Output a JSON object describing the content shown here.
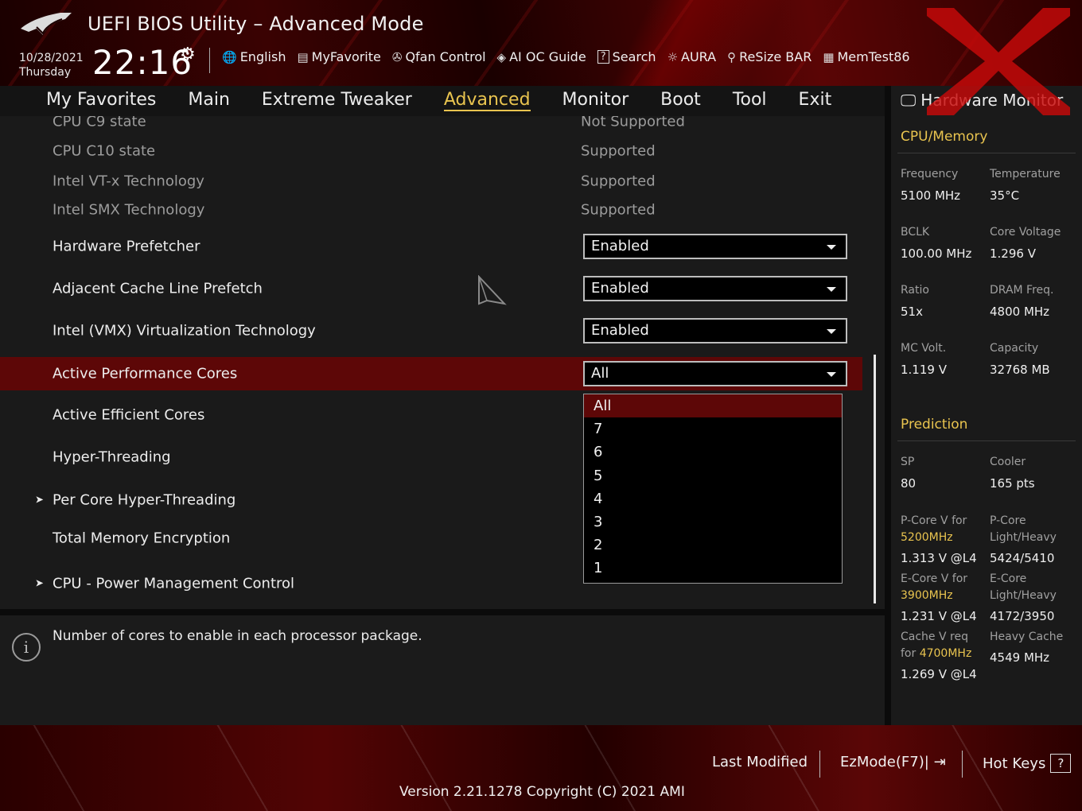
{
  "header": {
    "title": "UEFI BIOS Utility – Advanced Mode",
    "date": "10/28/2021",
    "day": "Thursday",
    "time": "22:16",
    "tools": [
      {
        "label": "English",
        "icon": "globe-icon"
      },
      {
        "label": "MyFavorite",
        "icon": "favorite-list-icon"
      },
      {
        "label": "Qfan Control",
        "icon": "fan-icon"
      },
      {
        "label": "AI OC Guide",
        "icon": "ai-chip-icon"
      },
      {
        "label": "Search",
        "icon": "help-search-icon"
      },
      {
        "label": "AURA",
        "icon": "aura-light-icon"
      },
      {
        "label": "ReSize BAR",
        "icon": "resize-bar-icon"
      },
      {
        "label": "MemTest86",
        "icon": "memtest-icon"
      }
    ]
  },
  "nav": {
    "tabs": [
      "My Favorites",
      "Main",
      "Extreme Tweaker",
      "Advanced",
      "Monitor",
      "Boot",
      "Tool",
      "Exit"
    ],
    "active": "Advanced"
  },
  "settings": {
    "c9_label": "CPU C9 state",
    "c9_value": "Not Supported",
    "c10_label": "CPU C10 state",
    "c10_value": "Supported",
    "vtx_label": "Intel VT-x Technology",
    "vtx_value": "Supported",
    "smx_label": "Intel SMX Technology",
    "smx_value": "Supported",
    "hwpf_label": "Hardware Prefetcher",
    "hwpf_value": "Enabled",
    "acl_label": "Adjacent Cache Line Prefetch",
    "acl_value": "Enabled",
    "vmx_label": "Intel (VMX) Virtualization Technology",
    "vmx_value": "Enabled",
    "apc_label": "Active Performance Cores",
    "apc_value": "All",
    "aec_label": "Active Efficient Cores",
    "ht_label": "Hyper-Threading",
    "pcht_label": "Per Core Hyper-Threading",
    "tme_label": "Total Memory Encryption",
    "pmc_label": "CPU - Power Management Control"
  },
  "dropdown_options": [
    "All",
    "7",
    "6",
    "5",
    "4",
    "3",
    "2",
    "1"
  ],
  "help_text": "Number of cores to enable in each processor package.",
  "hw_monitor": {
    "title": "Hardware Monitor",
    "cpu_section": "CPU/Memory",
    "frequency_label": "Frequency",
    "frequency": "5100 MHz",
    "temperature_label": "Temperature",
    "temperature": "35°C",
    "bclk_label": "BCLK",
    "bclk": "100.00 MHz",
    "core_voltage_label": "Core Voltage",
    "core_voltage": "1.296 V",
    "ratio_label": "Ratio",
    "ratio": "51x",
    "dram_label": "DRAM Freq.",
    "dram": "4800 MHz",
    "mcvolt_label": "MC Volt.",
    "mcvolt": "1.119 V",
    "capacity_label": "Capacity",
    "capacity": "32768 MB",
    "prediction_section": "Prediction",
    "sp_label": "SP",
    "sp": "80",
    "cooler_label": "Cooler",
    "cooler": "165 pts",
    "pcore_v_label": "P-Core V for",
    "pcore_v_freq": "5200MHz",
    "pcore_v": "1.313 V @L4",
    "pcore_lh_label_1": "P-Core",
    "pcore_lh_label_2": "Light/Heavy",
    "pcore_lh": "5424/5410",
    "ecore_v_label": "E-Core V for",
    "ecore_v_freq": "3900MHz",
    "ecore_v": "1.231 V @L4",
    "ecore_lh_label_1": "E-Core",
    "ecore_lh_label_2": "Light/Heavy",
    "ecore_lh": "4172/3950",
    "cache_v_label": "Cache V req",
    "cache_v_for": "for",
    "cache_v_freq": "4700MHz",
    "cache_v": "1.269 V @L4",
    "heavy_cache_label": "Heavy Cache",
    "heavy_cache": "4549 MHz"
  },
  "footer": {
    "last_modified": "Last Modified",
    "ezmode": "EzMode(F7)|",
    "hotkeys": "Hot Keys",
    "hotkeys_key": "?",
    "version": "Version 2.21.1278 Copyright (C) 2021 AMI"
  },
  "colors": {
    "accent": "#e9c44f",
    "selected_row": "#5d0707",
    "header_red": "#3a0202"
  }
}
